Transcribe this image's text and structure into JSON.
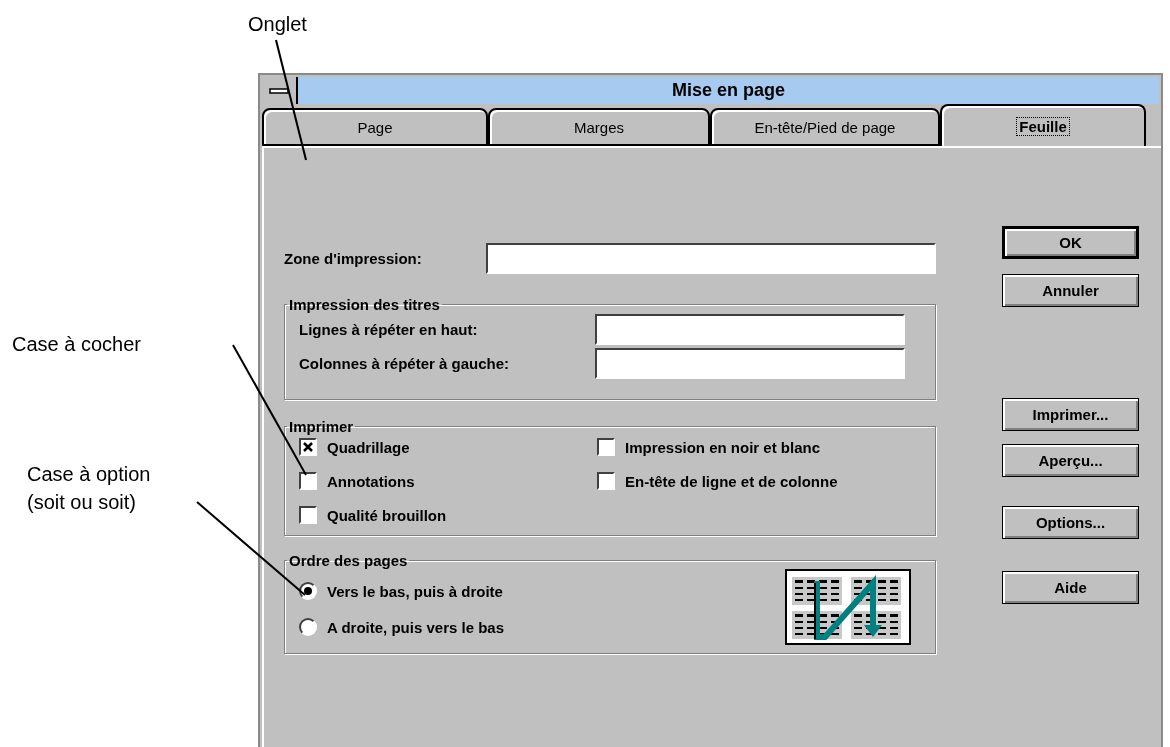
{
  "annotations": [
    {
      "lines": [
        "Onglet"
      ]
    },
    {
      "lines": [
        "Case à cocher"
      ]
    },
    {
      "lines": [
        "Case à option",
        "(soit ou soit)"
      ]
    }
  ],
  "dialog": {
    "title": "Mise en page",
    "tabs": [
      {
        "label": "Page",
        "selected": false
      },
      {
        "label": "Marges",
        "selected": false
      },
      {
        "label": "En-tête/Pied de page",
        "selected": false
      },
      {
        "label": "Feuille",
        "selected": true
      }
    ],
    "print_area": {
      "label": "Zone d'impression:"
    },
    "titles_group": {
      "title": "Impression des titres",
      "rows": [
        {
          "label": "Lignes à répéter en haut:"
        },
        {
          "label": "Colonnes à répéter à gauche:"
        }
      ]
    },
    "print_group": {
      "title": "Imprimer",
      "left": [
        {
          "label": "Quadrillage",
          "checked": true
        },
        {
          "label": "Annotations",
          "checked": false
        },
        {
          "label": "Qualité brouillon",
          "checked": false
        }
      ],
      "right": [
        {
          "label": "Impression en noir et blanc",
          "checked": false
        },
        {
          "label": "En-tête de ligne et de colonne",
          "checked": false
        }
      ]
    },
    "page_order": {
      "title": "Ordre des pages",
      "options": [
        {
          "label": "Vers le bas, puis à droite",
          "selected": true
        },
        {
          "label": "A droite, puis vers le bas",
          "selected": false
        }
      ]
    },
    "buttons": [
      {
        "label": "OK",
        "default": true
      },
      {
        "label": "Annuler",
        "default": false
      },
      {
        "label": "Imprimer...",
        "default": false
      },
      {
        "label": "Aperçu...",
        "default": false
      },
      {
        "label": "Options...",
        "default": false
      },
      {
        "label": "Aide",
        "default": false
      }
    ]
  }
}
